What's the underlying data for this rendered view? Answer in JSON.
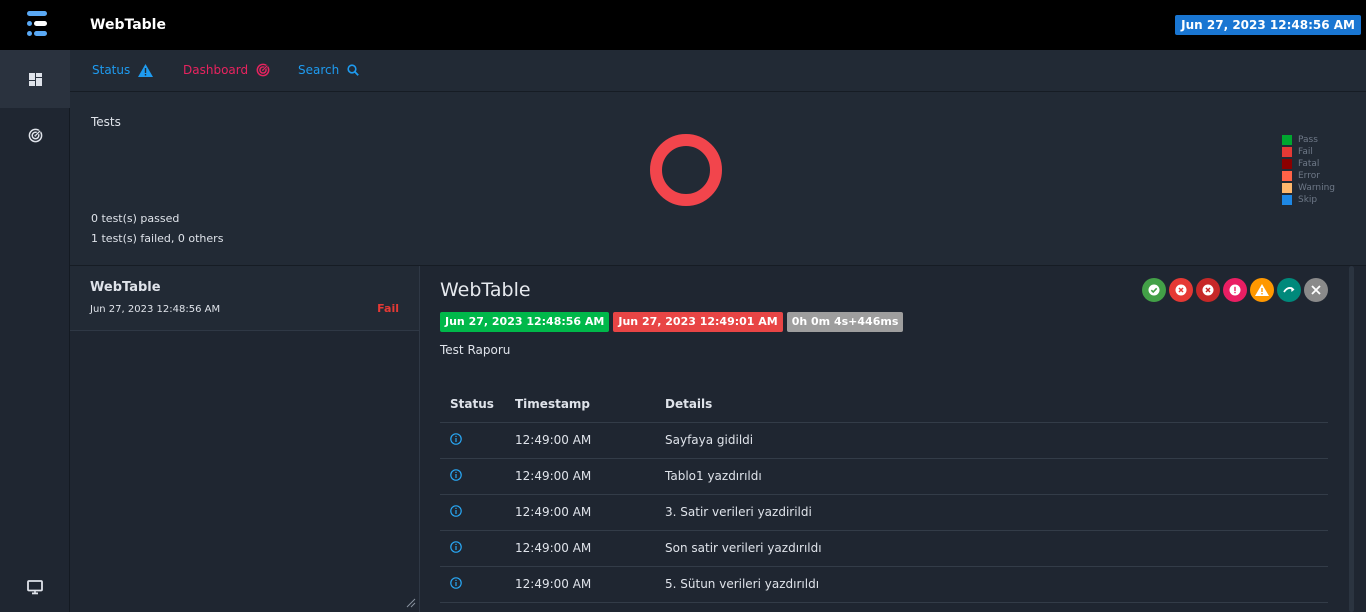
{
  "app": {
    "title": "WebTable",
    "date_badge": "Jun 27, 2023 12:48:56 AM"
  },
  "rail": {
    "items": [
      {
        "icon": "dashboard-grid-icon"
      },
      {
        "icon": "radar-icon"
      },
      {
        "icon": "monitor-icon"
      }
    ]
  },
  "nav": {
    "status": "Status",
    "dashboard": "Dashboard",
    "search": "Search"
  },
  "tests": {
    "title": "Tests",
    "passed": "0 test(s) passed",
    "failed": "1 test(s) failed, 0 others",
    "legend": [
      {
        "label": "Pass",
        "color": "#00a62f"
      },
      {
        "label": "Fail",
        "color": "#e53935"
      },
      {
        "label": "Fatal",
        "color": "#8b0000"
      },
      {
        "label": "Error",
        "color": "#ff6347"
      },
      {
        "label": "Warning",
        "color": "#ffb86c"
      },
      {
        "label": "Skip",
        "color": "#1e88e5"
      }
    ]
  },
  "list": {
    "items": [
      {
        "name": "WebTable",
        "date": "Jun 27, 2023 12:48:56 AM",
        "status": "Fail"
      }
    ]
  },
  "detail": {
    "title": "WebTable",
    "start": "Jun 27, 2023 12:48:56 AM",
    "end": "Jun 27, 2023 12:49:01 AM",
    "duration": "0h 0m 4s+446ms",
    "description": "Test Raporu",
    "columns": [
      "Status",
      "Timestamp",
      "Details"
    ],
    "rows": [
      {
        "time": "12:49:00 AM",
        "details": "Sayfaya gidildi"
      },
      {
        "time": "12:49:00 AM",
        "details": "Tablo1 yazdırıldı"
      },
      {
        "time": "12:49:00 AM",
        "details": "3. Satir verileri yazdirildi"
      },
      {
        "time": "12:49:00 AM",
        "details": "Son satir verileri yazdırıldı"
      },
      {
        "time": "12:49:00 AM",
        "details": "5. Sütun verileri yazdırıldı"
      }
    ],
    "status_filters": [
      {
        "name": "pass",
        "color": "#43a047"
      },
      {
        "name": "fail",
        "color": "#e53935"
      },
      {
        "name": "fatal",
        "color": "#c62828"
      },
      {
        "name": "error",
        "color": "#e91e63"
      },
      {
        "name": "warning",
        "color": "#ff9800"
      },
      {
        "name": "skip",
        "color": "#00897b"
      },
      {
        "name": "clear",
        "color": "#8a8a8a"
      }
    ]
  }
}
